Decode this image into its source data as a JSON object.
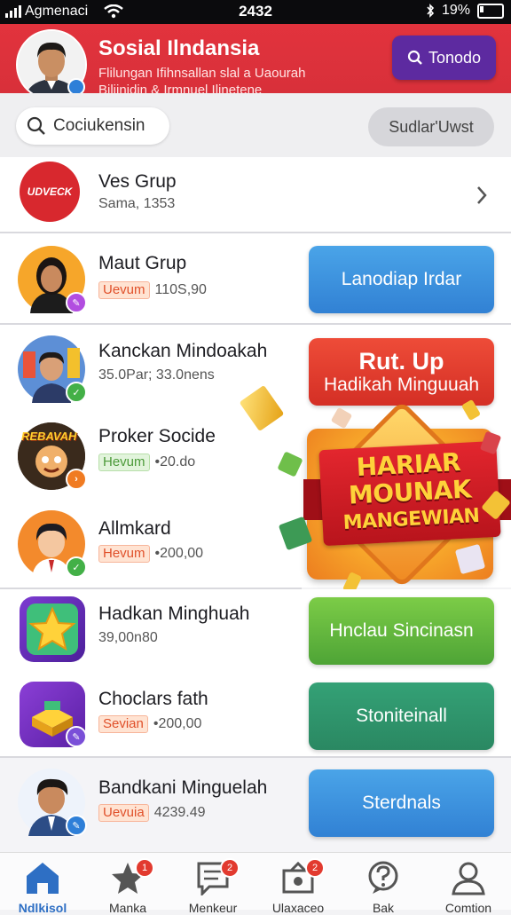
{
  "status_bar": {
    "carrier": "Agmenaci",
    "time": "2432",
    "battery": "19%"
  },
  "header": {
    "title": "Sosial Ilndansia",
    "subtitle_line1": "Flilungan Ifihnsallan slal a Uaourah",
    "subtitle_line2": "Biljinidin & Irmnuel Ilinetene",
    "button_label": "Tonodo"
  },
  "search": {
    "placeholder": "Cociukensin",
    "button_label": "Sudlar'Uwst"
  },
  "groups": [
    {
      "name": "Ves Grup",
      "meta": "Sama, 1353",
      "logo_text": "UDVECK"
    },
    {
      "name": "Maut Grup",
      "tag": "Uevum",
      "value": "110S,90",
      "action": "Lanodiap Irdar"
    },
    {
      "name": "Kanckan Mindoakah",
      "meta": "35.0Par; 33.0nens"
    },
    {
      "name": "Proker Socide",
      "tag": "Hevum",
      "value": "•20.do",
      "logo_text": "REBAVAH"
    },
    {
      "name": "Allmkard",
      "tag": "Hevum",
      "value": "•200,00"
    },
    {
      "name": "Hadkan Minghuah",
      "meta": "39,00n80",
      "action": "Hnclau Sincinasn"
    },
    {
      "name": "Choclars fath",
      "tag": "Sevian",
      "value": "•200,00",
      "action": "Stoniteinall"
    },
    {
      "name": "Bandkani Minguelah",
      "tag": "Uevuia",
      "value": "4239.49",
      "action": "Sterdnals"
    }
  ],
  "red_action": {
    "line1": "Rut. Up",
    "line2": "Hadikah Minguuah"
  },
  "promo": {
    "line1": "HARIAR",
    "line2": "MOUNAK",
    "line3": "MANGEWIAN"
  },
  "nav": [
    {
      "label": "Ndlkisol",
      "icon": "home-icon"
    },
    {
      "label": "Manka",
      "icon": "star-icon",
      "badge": "1"
    },
    {
      "label": "Menkeur",
      "icon": "chat-icon",
      "badge": "2"
    },
    {
      "label": "Ulaxaceo",
      "icon": "group-icon",
      "badge": "2"
    },
    {
      "label": "Bak",
      "icon": "help-icon"
    },
    {
      "label": "Comtion",
      "icon": "profile-icon"
    }
  ],
  "colors": {
    "header": "#e2333d",
    "accent_purple": "#5d2aa0",
    "nav_active": "#2e6fc4"
  }
}
